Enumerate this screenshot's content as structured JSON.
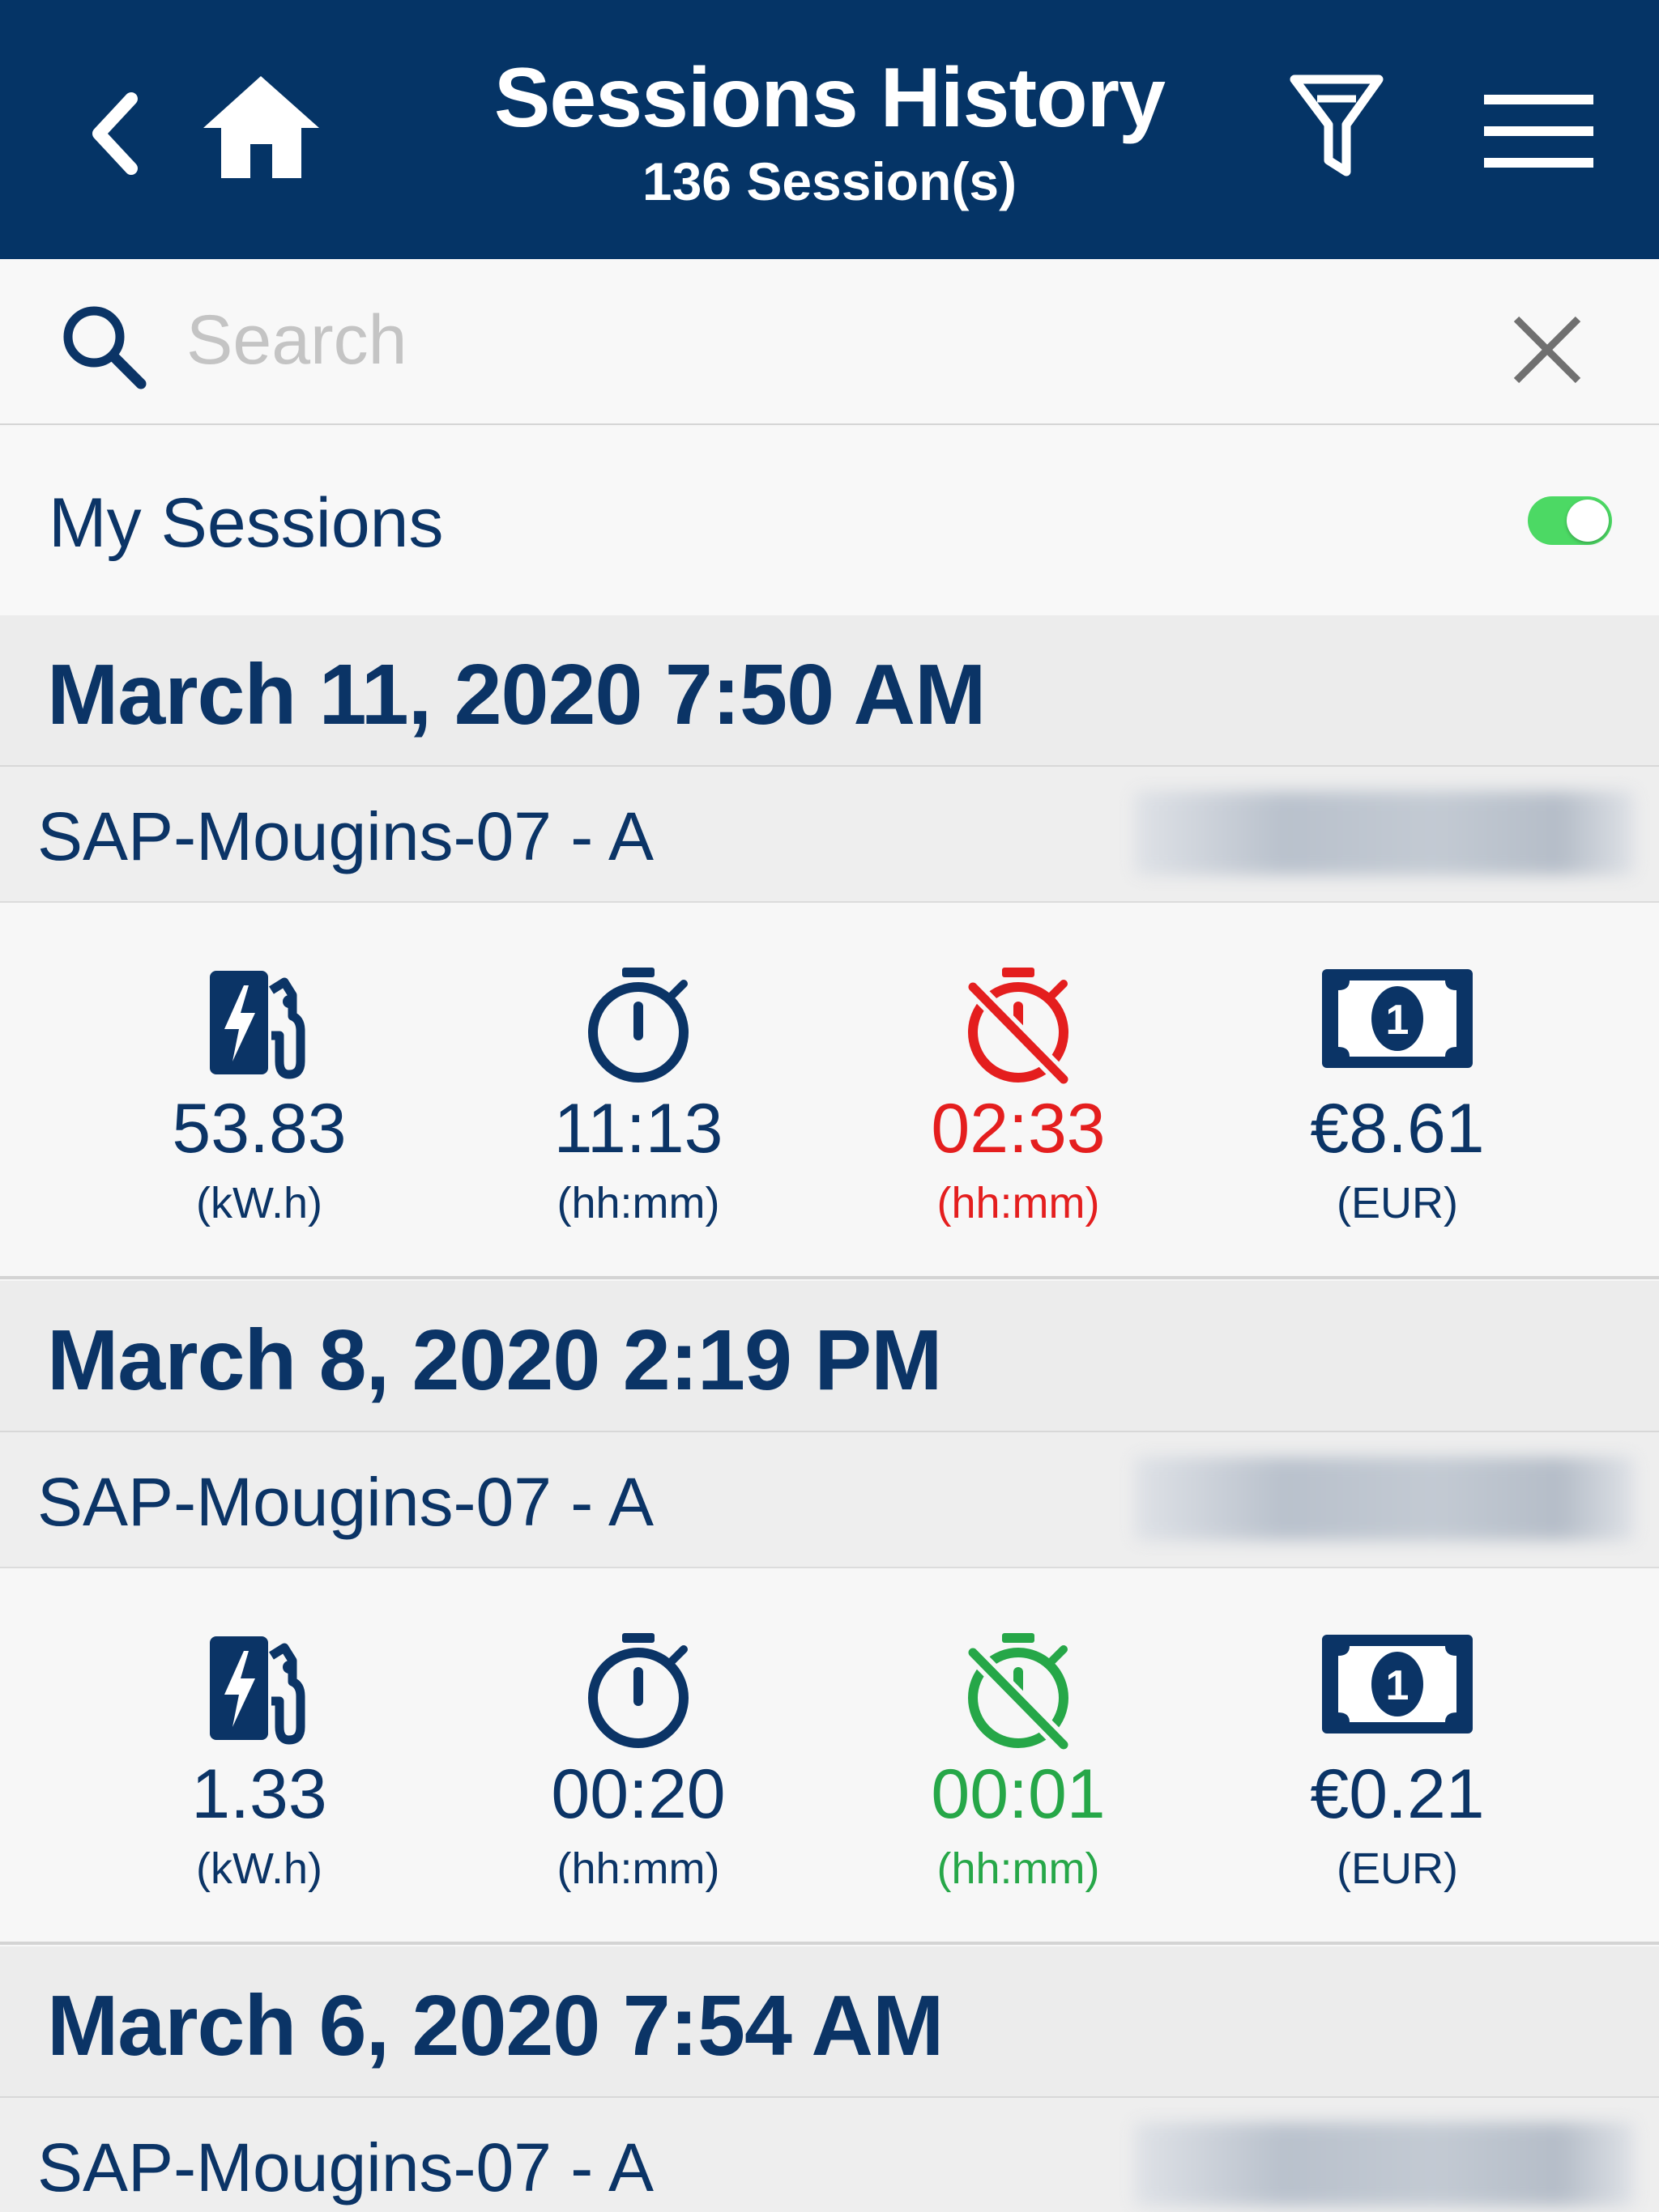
{
  "header": {
    "title": "Sessions History",
    "subtitle": "136 Session(s)"
  },
  "search": {
    "placeholder": "Search",
    "value": ""
  },
  "filter": {
    "my_sessions_label": "My Sessions",
    "my_sessions_on": true
  },
  "colors": {
    "navbar": "#053466",
    "primary_text": "#0b3466",
    "toggle_on": "#4cd964",
    "alert_red": "#e41e1e",
    "ok_green": "#26a748"
  },
  "sessions": [
    {
      "date": "March 11, 2020 7:50 AM",
      "station": "SAP-Mougins-07 - A",
      "energy": {
        "value": "53.83",
        "unit": "(kW.h)",
        "icon": "charging-station-icon"
      },
      "duration": {
        "value": "11:13",
        "unit": "(hh:mm)",
        "icon": "stopwatch-icon"
      },
      "inactivity": {
        "value": "02:33",
        "unit": "(hh:mm)",
        "icon": "stopwatch-off-icon",
        "status": "red"
      },
      "price": {
        "value": "€8.61",
        "unit": "(EUR)",
        "icon": "money-icon"
      }
    },
    {
      "date": "March 8, 2020 2:19 PM",
      "station": "SAP-Mougins-07 - A",
      "energy": {
        "value": "1.33",
        "unit": "(kW.h)",
        "icon": "charging-station-icon"
      },
      "duration": {
        "value": "00:20",
        "unit": "(hh:mm)",
        "icon": "stopwatch-icon"
      },
      "inactivity": {
        "value": "00:01",
        "unit": "(hh:mm)",
        "icon": "stopwatch-off-icon",
        "status": "green"
      },
      "price": {
        "value": "€0.21",
        "unit": "(EUR)",
        "icon": "money-icon"
      }
    },
    {
      "date": "March 6, 2020 7:54 AM",
      "station": "SAP-Mougins-07 - A"
    }
  ]
}
